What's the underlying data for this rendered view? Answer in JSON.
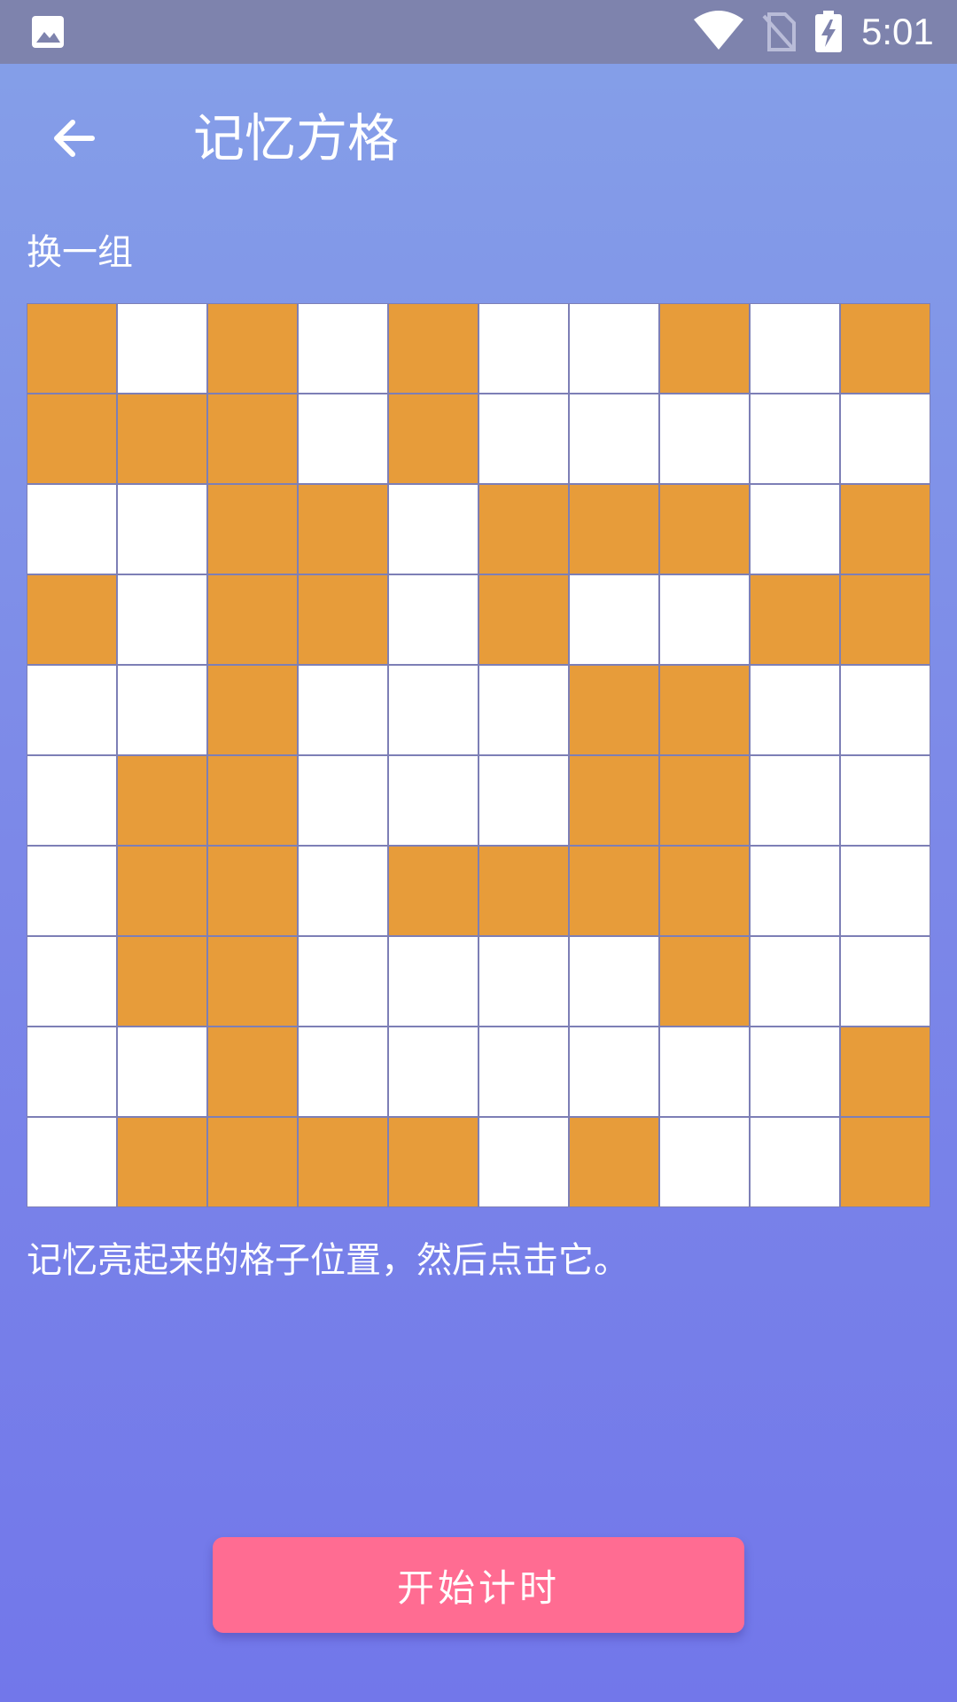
{
  "status_bar": {
    "time": "5:01",
    "icons": [
      "image-icon",
      "wifi-icon",
      "no-sim-icon",
      "battery-charging-icon"
    ]
  },
  "app_bar": {
    "title": "记忆方格",
    "back_icon": "arrow-left-icon"
  },
  "shuffle_label": "换一组",
  "grid": {
    "rows": 10,
    "cols": 10,
    "lit_color": "#e79c3a",
    "empty_color": "#ffffff",
    "cells": [
      [
        1,
        0,
        1,
        0,
        1,
        0,
        0,
        1,
        0,
        1
      ],
      [
        1,
        1,
        1,
        0,
        1,
        0,
        0,
        0,
        0,
        0
      ],
      [
        0,
        0,
        1,
        1,
        0,
        1,
        1,
        1,
        0,
        1
      ],
      [
        1,
        0,
        1,
        1,
        0,
        1,
        0,
        0,
        1,
        1
      ],
      [
        0,
        0,
        1,
        0,
        0,
        0,
        1,
        1,
        0,
        0
      ],
      [
        0,
        1,
        1,
        0,
        0,
        0,
        1,
        1,
        0,
        0
      ],
      [
        0,
        1,
        1,
        0,
        1,
        1,
        1,
        1,
        0,
        0
      ],
      [
        0,
        1,
        1,
        0,
        0,
        0,
        0,
        1,
        0,
        0
      ],
      [
        0,
        0,
        1,
        0,
        0,
        0,
        0,
        0,
        0,
        1
      ],
      [
        0,
        1,
        1,
        1,
        1,
        0,
        1,
        0,
        0,
        1
      ]
    ]
  },
  "instruction": "记忆亮起来的格子位置，然后点击它。",
  "start_button": {
    "label": "开始计时",
    "color": "#ff6c92"
  }
}
